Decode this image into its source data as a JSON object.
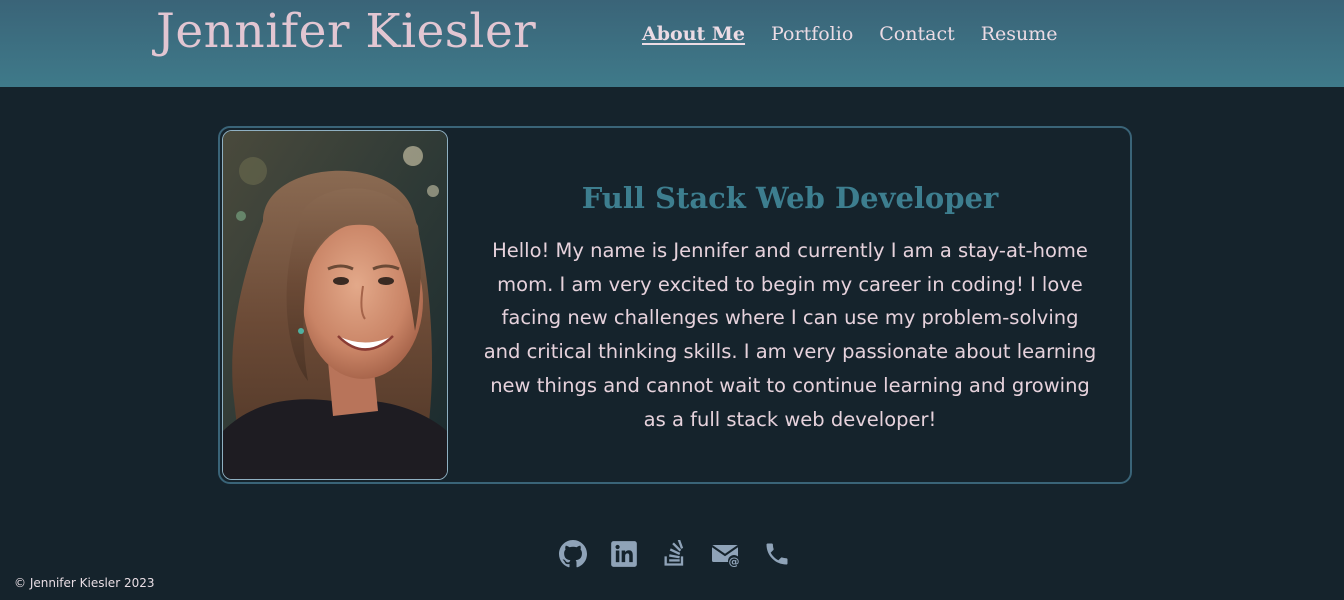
{
  "header": {
    "site_title": "Jennifer Kiesler",
    "nav": [
      {
        "label": "About Me",
        "active": true
      },
      {
        "label": "Portfolio",
        "active": false
      },
      {
        "label": "Contact",
        "active": false
      },
      {
        "label": "Resume",
        "active": false
      }
    ]
  },
  "about": {
    "heading": "Full Stack Web Developer",
    "bio": "Hello! My name is Jennifer and currently I am a stay-at-home mom. I am very excited to begin my career in coding! I love facing new challenges where I can use my problem-solving and critical thinking skills. I am very passionate about learning new things and cannot wait to continue learning and growing as a full stack web developer!",
    "photo_icon": "portrait-photo"
  },
  "socials": [
    {
      "icon": "github-icon"
    },
    {
      "icon": "linkedin-icon"
    },
    {
      "icon": "stackoverflow-icon"
    },
    {
      "icon": "email-icon"
    },
    {
      "icon": "phone-icon"
    }
  ],
  "footer": {
    "copyright": "© Jennifer Kiesler 2023"
  },
  "colors": {
    "header_bg": "#3f7a8a",
    "page_bg": "#15232c",
    "accent": "#3d7e8f",
    "title_text": "#e2c6d2",
    "body_text": "#e6d2dc",
    "icon_color": "#8fa3b8"
  }
}
